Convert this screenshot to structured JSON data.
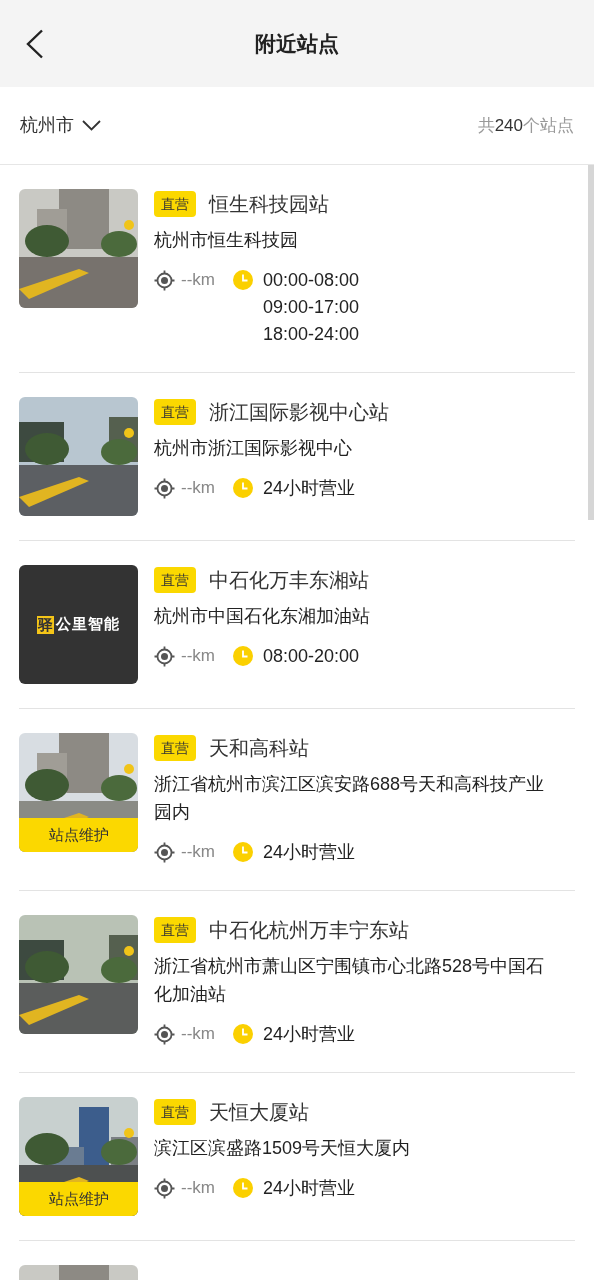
{
  "header": {
    "title": "附近站点"
  },
  "city_bar": {
    "city": "杭州市",
    "count_prefix": "共",
    "count": "240",
    "count_suffix": "个站点"
  },
  "stations": [
    {
      "tag": "直营",
      "name": "恒生科技园站",
      "address": "杭州市恒生科技园",
      "distance": "--km",
      "hours": [
        "00:00-08:00",
        "09:00-17:00",
        "18:00-24:00"
      ]
    },
    {
      "tag": "直营",
      "name": "浙江国际影视中心站",
      "address": "杭州市浙江国际影视中心",
      "distance": "--km",
      "hours": [
        "24小时营业"
      ]
    },
    {
      "tag": "直营",
      "name": "中石化万丰东湘站",
      "address": "杭州市中国石化东湘加油站",
      "distance": "--km",
      "hours": [
        "08:00-20:00"
      ],
      "image": {
        "kind": "logo",
        "mark": "驿",
        "text": "公里智能"
      }
    },
    {
      "tag": "直营",
      "name": "天和高科站",
      "address": "浙江省杭州市滨江区滨安路688号天和高科技产业园内",
      "distance": "--km",
      "hours": [
        "24小时营业"
      ],
      "image": {
        "kind": "picture",
        "status": "站点维护"
      }
    },
    {
      "tag": "直营",
      "name": "中石化杭州万丰宁东站",
      "address": "浙江省杭州市萧山区宁围镇市心北路528号中国石化加油站",
      "distance": "--km",
      "hours": [
        "24小时营业"
      ]
    },
    {
      "tag": "直营",
      "name": "天恒大厦站",
      "address": "滨江区滨盛路1509号天恒大厦内",
      "distance": "--km",
      "hours": [
        "24小时营业"
      ],
      "image": {
        "kind": "picture",
        "status": "站点维护"
      }
    }
  ]
}
